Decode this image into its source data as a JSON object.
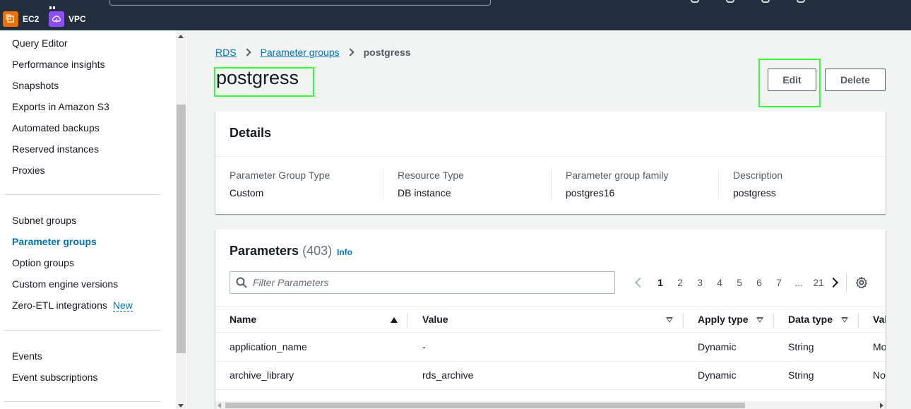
{
  "favorites": [
    {
      "label": "EC2",
      "icon": "ec2-icon",
      "color": "#ed7100"
    },
    {
      "label": "VPC",
      "icon": "vpc-icon",
      "color": "#8c4fff"
    }
  ],
  "sidebar": {
    "items": [
      {
        "label": "Query Editor"
      },
      {
        "label": "Performance insights"
      },
      {
        "label": "Snapshots"
      },
      {
        "label": "Exports in Amazon S3"
      },
      {
        "label": "Automated backups"
      },
      {
        "label": "Reserved instances"
      },
      {
        "label": "Proxies"
      },
      {
        "label": "Subnet groups"
      },
      {
        "label": "Parameter groups",
        "active": true
      },
      {
        "label": "Option groups"
      },
      {
        "label": "Custom engine versions"
      },
      {
        "label": "Zero-ETL integrations",
        "badge": "New"
      },
      {
        "label": "Events"
      },
      {
        "label": "Event subscriptions"
      }
    ]
  },
  "breadcrumb": {
    "items": [
      "RDS",
      "Parameter groups"
    ],
    "current": "postgress"
  },
  "page": {
    "title": "postgress",
    "edit_label": "Edit",
    "delete_label": "Delete"
  },
  "details": {
    "header": "Details",
    "fields": [
      {
        "key": "Parameter Group Type",
        "value": "Custom"
      },
      {
        "key": "Resource Type",
        "value": "DB instance"
      },
      {
        "key": "Parameter group family",
        "value": "postgres16"
      },
      {
        "key": "Description",
        "value": "postgress"
      }
    ]
  },
  "parameters": {
    "title": "Parameters",
    "count": "(403)",
    "info_label": "Info",
    "filter_placeholder": "Filter Parameters",
    "pagination": {
      "pages": [
        "1",
        "2",
        "3",
        "4",
        "5",
        "6",
        "7",
        "...",
        "21"
      ],
      "current": "1"
    },
    "columns": [
      "Name",
      "Value",
      "Apply type",
      "Data type",
      "Val"
    ],
    "rows": [
      {
        "name": "application_name",
        "value": "-",
        "apply_type": "Dynamic",
        "data_type": "String",
        "val": "Mo"
      },
      {
        "name": "archive_library",
        "value": "rds_archive",
        "apply_type": "Dynamic",
        "data_type": "String",
        "val": "No"
      }
    ]
  }
}
